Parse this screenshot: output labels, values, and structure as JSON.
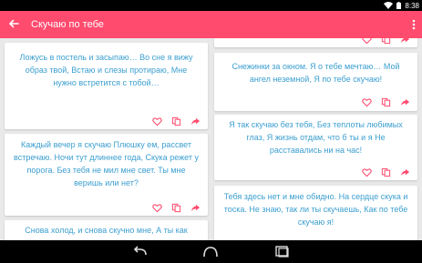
{
  "status_bar": {
    "time": "8:38"
  },
  "app_bar": {
    "title": "Скучаю по тебе",
    "accent_color": "#ff4b6e"
  },
  "cards": [
    {
      "text": "Ложусь в постель и засыпаю… Во сне я вижу образ твой, Встаю и слезы протираю, Мне нужно встретится с тобой…"
    },
    {
      "text": "Каждый вечер я скучаю Плюшку ем, рассвет встречаю. Ночи тут длиннее года, Скука режет у порога. Без тебя не мил мне свет. Ты мне веришь или нет?"
    },
    {
      "text": "Снова холод, и снова скучно мне, А ты как"
    },
    {
      "text": "Снежинки за окном. Я о тебе мечтаю… Мой ангел неземной, Я по тебе скучаю!"
    },
    {
      "text": "Я так скучаю без тебя, Без теплоты любимых глаз, Я жизнь отдам, что б ты и я Не расставались ни на час!"
    },
    {
      "text": "Тебя здесь нет и мне обидно. На сердце скука и тоска. Не знаю, так ли ты скучаешь, Как по тебе скучаю я!"
    }
  ],
  "icons": {
    "like": "heart-outline-icon",
    "copy": "copy-icon",
    "share": "share-icon",
    "text_color": "#3c9fd0"
  }
}
